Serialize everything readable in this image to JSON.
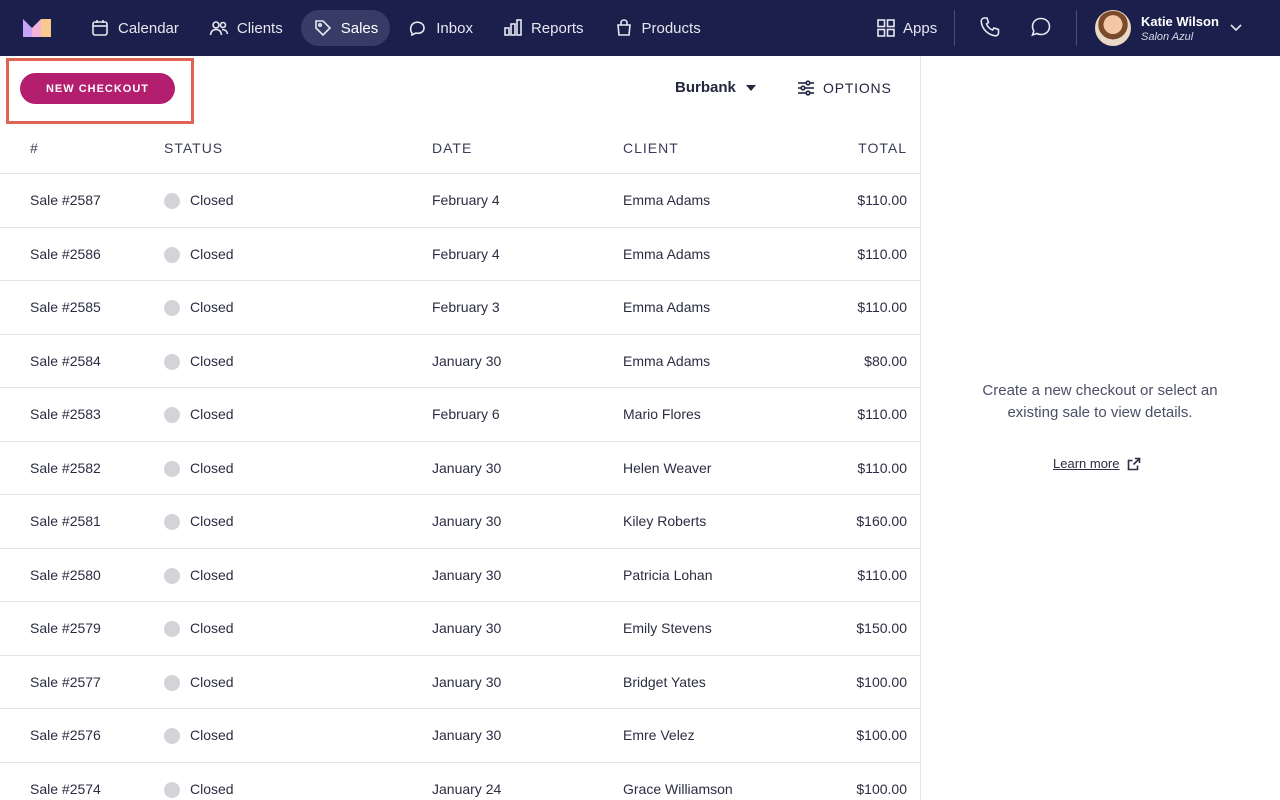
{
  "nav": {
    "items": [
      {
        "label": "Calendar",
        "icon": "calendar-icon",
        "active": false
      },
      {
        "label": "Clients",
        "icon": "clients-icon",
        "active": false
      },
      {
        "label": "Sales",
        "icon": "tag-icon",
        "active": true
      },
      {
        "label": "Inbox",
        "icon": "inbox-icon",
        "active": false
      },
      {
        "label": "Reports",
        "icon": "reports-icon",
        "active": false
      },
      {
        "label": "Products",
        "icon": "bag-icon",
        "active": false
      }
    ],
    "apps_label": "Apps",
    "user": {
      "name": "Katie Wilson",
      "org": "Salon Azul"
    }
  },
  "toolbar": {
    "new_checkout_label": "NEW CHECKOUT",
    "location": "Burbank",
    "options_label": "OPTIONS"
  },
  "table": {
    "headers": [
      "#",
      "STATUS",
      "DATE",
      "CLIENT",
      "TOTAL"
    ],
    "rows": [
      {
        "num": "Sale #2587",
        "status": "Closed",
        "date": "February 4",
        "client": "Emma Adams",
        "total": "$110.00"
      },
      {
        "num": "Sale #2586",
        "status": "Closed",
        "date": "February 4",
        "client": "Emma Adams",
        "total": "$110.00"
      },
      {
        "num": "Sale #2585",
        "status": "Closed",
        "date": "February 3",
        "client": "Emma Adams",
        "total": "$110.00"
      },
      {
        "num": "Sale #2584",
        "status": "Closed",
        "date": "January 30",
        "client": "Emma Adams",
        "total": "$80.00"
      },
      {
        "num": "Sale #2583",
        "status": "Closed",
        "date": "February 6",
        "client": "Mario Flores",
        "total": "$110.00"
      },
      {
        "num": "Sale #2582",
        "status": "Closed",
        "date": "January 30",
        "client": "Helen Weaver",
        "total": "$110.00"
      },
      {
        "num": "Sale #2581",
        "status": "Closed",
        "date": "January 30",
        "client": "Kiley Roberts",
        "total": "$160.00"
      },
      {
        "num": "Sale #2580",
        "status": "Closed",
        "date": "January 30",
        "client": "Patricia Lohan",
        "total": "$110.00"
      },
      {
        "num": "Sale #2579",
        "status": "Closed",
        "date": "January 30",
        "client": "Emily Stevens",
        "total": "$150.00"
      },
      {
        "num": "Sale #2577",
        "status": "Closed",
        "date": "January 30",
        "client": "Bridget Yates",
        "total": "$100.00"
      },
      {
        "num": "Sale #2576",
        "status": "Closed",
        "date": "January 30",
        "client": "Emre Velez",
        "total": "$100.00"
      },
      {
        "num": "Sale #2574",
        "status": "Closed",
        "date": "January 24",
        "client": "Grace Williamson",
        "total": "$100.00"
      }
    ]
  },
  "detail_panel": {
    "empty_message": "Create a new checkout or select an existing sale to view details.",
    "learn_more_label": "Learn more"
  },
  "colors": {
    "nav_bg": "#1b1f4b",
    "accent": "#b31f6e",
    "highlight": "#e06454"
  }
}
